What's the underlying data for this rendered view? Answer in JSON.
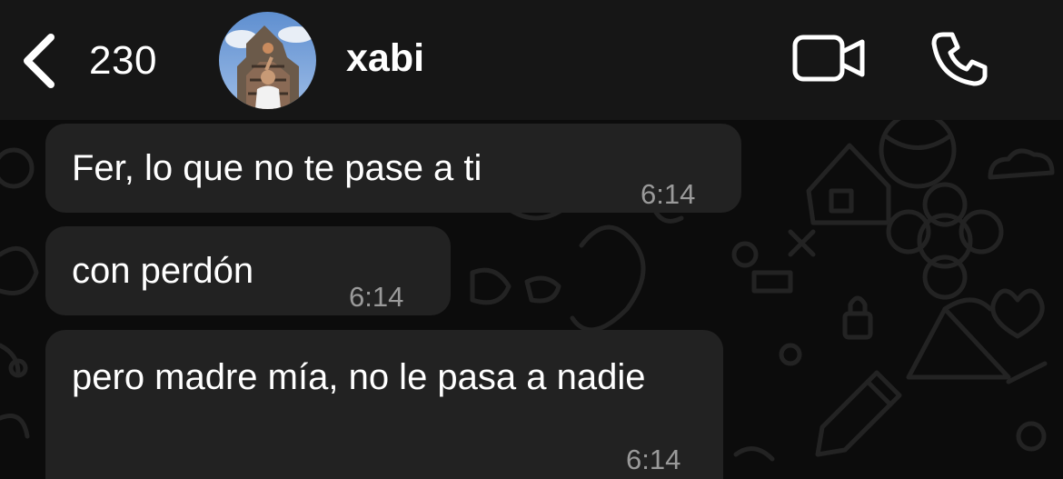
{
  "header": {
    "back_count": "230",
    "contact_name": "xabi",
    "back_icon": "chevron-left-icon",
    "video_icon": "video-camera-icon",
    "call_icon": "phone-icon"
  },
  "messages": [
    {
      "text": "Fer, lo que no te pase a ti",
      "time": "6:14"
    },
    {
      "text": "con perdón",
      "time": "6:14"
    },
    {
      "text": "pero madre mía, no le pasa a nadie",
      "time": "6:14"
    }
  ],
  "colors": {
    "header_bg": "#161616",
    "bubble_bg": "#222222",
    "chat_bg": "#0c0c0c",
    "timestamp": "#9a9a9a"
  }
}
